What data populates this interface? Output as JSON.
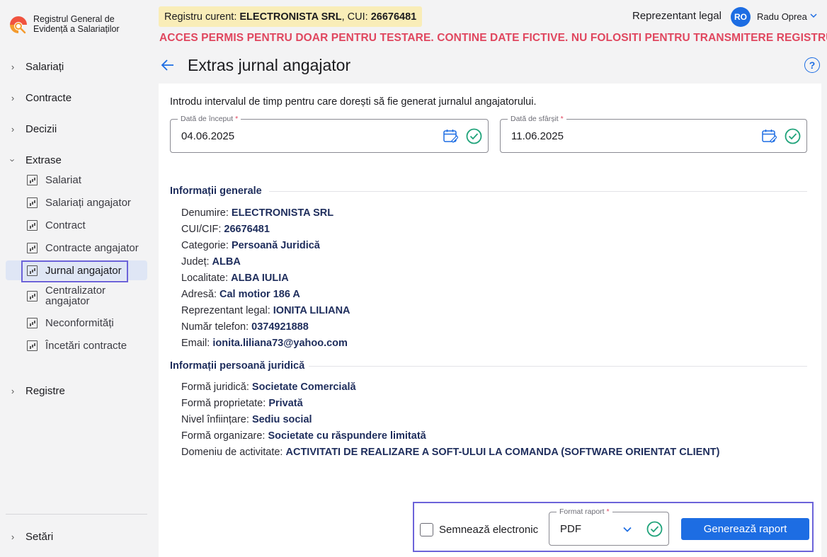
{
  "app": {
    "logo_text": "Registrul General de Evidență a Salariaților"
  },
  "sidebar": {
    "groups": [
      {
        "label": "Salariați"
      },
      {
        "label": "Contracte"
      },
      {
        "label": "Decizii"
      },
      {
        "label": "Extrase"
      },
      {
        "label": "Registre"
      },
      {
        "label": "Setări"
      }
    ],
    "extrase_items": [
      {
        "label": "Salariat"
      },
      {
        "label": "Salariați angajator"
      },
      {
        "label": "Contract"
      },
      {
        "label": "Contracte angajator"
      },
      {
        "label": "Jurnal angajator"
      },
      {
        "label": "Centralizator angajator"
      },
      {
        "label": "Neconformități"
      },
      {
        "label": "Încetări contracte"
      }
    ]
  },
  "header": {
    "registry_prefix": "Registru curent: ",
    "registry_name": "ELECTRONISTA SRL",
    "cui_prefix": ", CUI: ",
    "cui": "26676481",
    "role": "Reprezentant legal",
    "avatar_initials": "RO",
    "user_name": "Radu Oprea",
    "warning": "ACCES PERMIS PENTRU DOAR PENTRU TESTARE. CONTINE DATE FICTIVE. NU FOLOSITI PENTRU TRANSMITERE REGISTRU"
  },
  "page": {
    "title": "Extras jurnal angajator",
    "help": "?",
    "intro": "Introdu intervalul de timp pentru care dorești să fie generat jurnalul angajatorului."
  },
  "form": {
    "start_label": "Dată de început",
    "start_value": "04.06.2025",
    "end_label": "Dată de sfârșit",
    "end_value": "11.06.2025",
    "required_mark": "*"
  },
  "general_info": {
    "title": "Informații generale",
    "rows": [
      {
        "label": "Denumire: ",
        "value": "ELECTRONISTA SRL"
      },
      {
        "label": "CUI/CIF: ",
        "value": "26676481"
      },
      {
        "label": "Categorie: ",
        "value": "Persoană Juridică"
      },
      {
        "label": "Județ: ",
        "value": "ALBA"
      },
      {
        "label": "Localitate: ",
        "value": "ALBA IULIA"
      },
      {
        "label": "Adresă: ",
        "value": "Cal motior 186 A"
      },
      {
        "label": "Reprezentant legal: ",
        "value": "IONITA LILIANA"
      },
      {
        "label": "Număr telefon: ",
        "value": "0374921888"
      },
      {
        "label": "Email: ",
        "value": "ionita.liliana73@yahoo.com"
      }
    ]
  },
  "legal_info": {
    "title": "Informații persoană juridică",
    "rows": [
      {
        "label": "Formă juridică: ",
        "value": "Societate Comercială"
      },
      {
        "label": "Formă proprietate: ",
        "value": "Privată"
      },
      {
        "label": "Nivel înființare: ",
        "value": "Sediu social"
      },
      {
        "label": "Formă organizare: ",
        "value": "Societate cu răspundere limitată"
      },
      {
        "label": "Domeniu de activitate: ",
        "value": "ACTIVITATI DE REALIZARE A SOFT-ULUI LA COMANDA (SOFTWARE ORIENTAT CLIENT)"
      }
    ]
  },
  "actions": {
    "sign_label": "Semnează electronic",
    "format_label": "Format raport",
    "format_value": "PDF",
    "generate_label": "Generează raport"
  },
  "colors": {
    "accent": "#1d6de3",
    "warning": "#e0475f",
    "success": "#1fa37a",
    "highlight": "#6c63d9"
  }
}
